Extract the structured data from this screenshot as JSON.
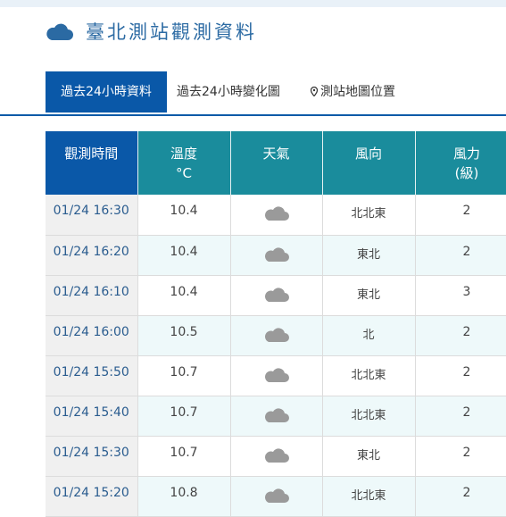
{
  "header": {
    "title": "臺北測站觀測資料",
    "icon": "cloud-icon"
  },
  "tabs": [
    {
      "label": "過去24小時資料",
      "active": true
    },
    {
      "label": "過去24小時變化圖",
      "active": false
    },
    {
      "label": "測站地圖位置",
      "active": false,
      "icon": "map-pin-icon"
    }
  ],
  "table": {
    "headers": {
      "time": "觀測時間",
      "temp": "溫度",
      "temp_unit": "°C",
      "weather": "天氣",
      "wind_dir": "風向",
      "wind_force": "風力",
      "wind_force_unit": "(級)"
    },
    "rows": [
      {
        "time": "01/24 16:30",
        "temp": "10.4",
        "weather": "cloudy-icon",
        "wind_dir": "北北東",
        "wind_force": "2"
      },
      {
        "time": "01/24 16:20",
        "temp": "10.4",
        "weather": "cloudy-icon",
        "wind_dir": "東北",
        "wind_force": "2"
      },
      {
        "time": "01/24 16:10",
        "temp": "10.4",
        "weather": "cloudy-icon",
        "wind_dir": "東北",
        "wind_force": "3"
      },
      {
        "time": "01/24 16:00",
        "temp": "10.5",
        "weather": "cloudy-icon",
        "wind_dir": "北",
        "wind_force": "2"
      },
      {
        "time": "01/24 15:50",
        "temp": "10.7",
        "weather": "cloudy-icon",
        "wind_dir": "北北東",
        "wind_force": "2"
      },
      {
        "time": "01/24 15:40",
        "temp": "10.7",
        "weather": "cloudy-icon",
        "wind_dir": "北北東",
        "wind_force": "2"
      },
      {
        "time": "01/24 15:30",
        "temp": "10.7",
        "weather": "cloudy-icon",
        "wind_dir": "東北",
        "wind_force": "2"
      },
      {
        "time": "01/24 15:20",
        "temp": "10.8",
        "weather": "cloudy-icon",
        "wind_dir": "北北東",
        "wind_force": "2"
      }
    ]
  },
  "colors": {
    "brand_blue": "#0a58a8",
    "header_teal": "#1a8c9c",
    "alt_row": "#eef9fa",
    "time_col": "#f0f0f0",
    "cloud_gray": "#9a9a9a"
  }
}
